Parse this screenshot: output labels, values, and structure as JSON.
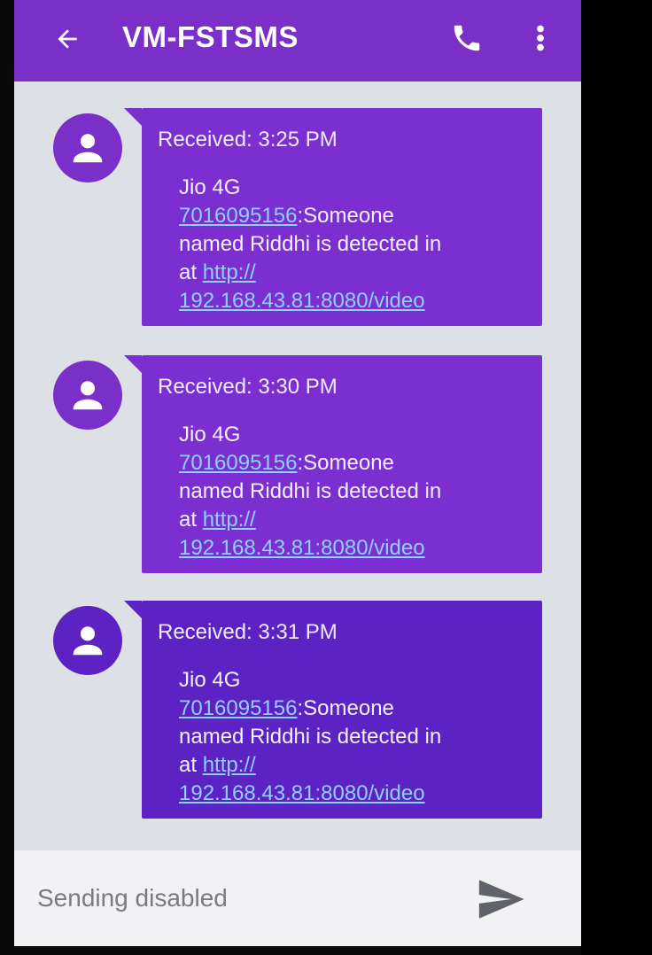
{
  "header": {
    "title": "VM-FSTSMS",
    "back_icon": "arrow-back-icon",
    "call_icon": "phone-icon",
    "more_icon": "more-vert-icon",
    "color": "#7b2fc9"
  },
  "messages": [
    {
      "received": "Received: 3:25 PM",
      "line1": "Jio 4G",
      "phone_link": "7016095156",
      "text_after_link": ":Someone",
      "line3": "named Riddhi is detected in",
      "at": "at ",
      "url_part1": "http://",
      "url_part2": "192.168.43.81:8080/video"
    },
    {
      "received": "Received: 3:30 PM",
      "line1": "Jio 4G",
      "phone_link": "7016095156",
      "text_after_link": ":Someone",
      "line3": "named Riddhi is detected in",
      "at": "at ",
      "url_part1": "http://",
      "url_part2": "192.168.43.81:8080/video"
    },
    {
      "received": "Received: 3:31 PM",
      "line1": "Jio 4G",
      "phone_link": "7016095156",
      "text_after_link": ":Someone",
      "line3": "named Riddhi is detected in",
      "at": "at ",
      "url_part1": "http://",
      "url_part2": "192.168.43.81:8080/video"
    }
  ],
  "composer": {
    "status": "Sending disabled",
    "send_icon": "send-icon"
  }
}
